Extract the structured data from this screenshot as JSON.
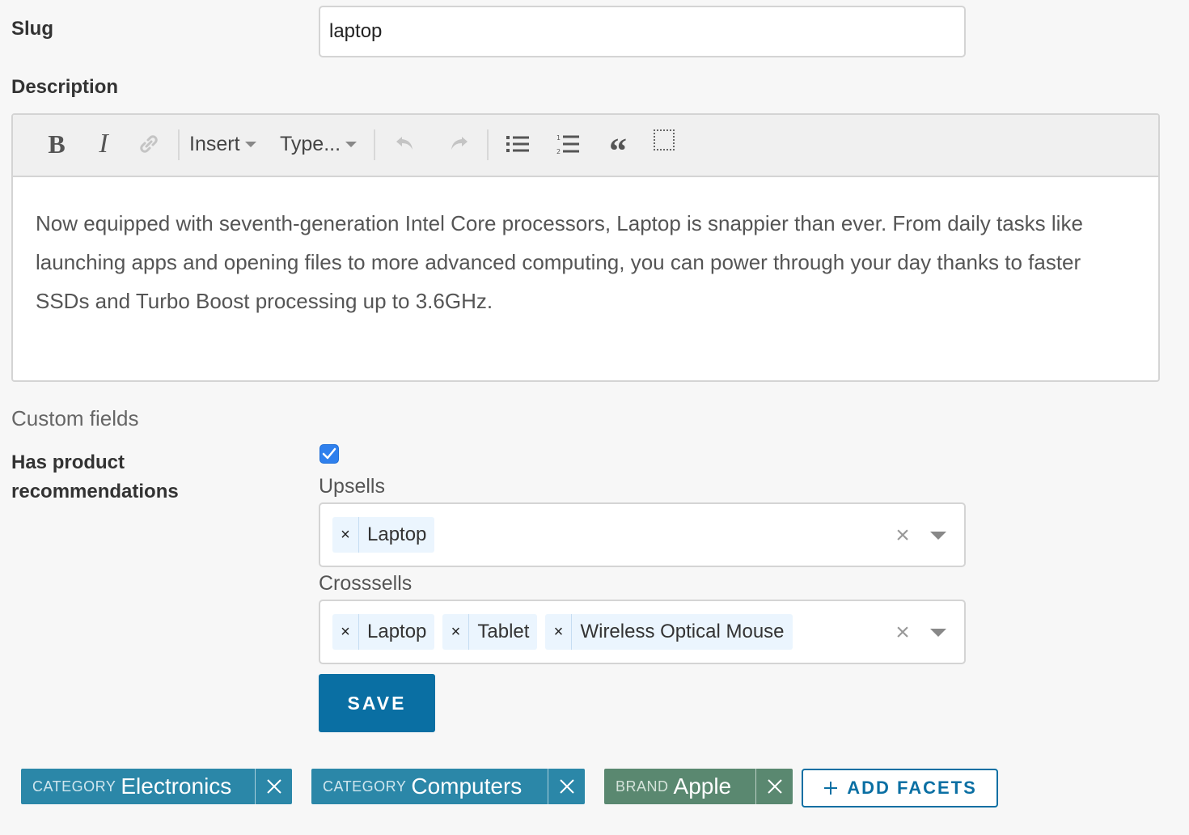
{
  "form": {
    "slug_label": "Slug",
    "slug_value": "laptop",
    "description_label": "Description",
    "description_text": "Now equipped with seventh-generation Intel Core processors, Laptop is snappier than ever. From daily tasks like launching apps and opening files to more advanced computing, you can power through your day thanks to faster SSDs and Turbo Boost processing up to 3.6GHz."
  },
  "toolbar": {
    "bold": "B",
    "italic": "I",
    "insert": "Insert",
    "type": "Type...",
    "quote": "“",
    "icons": [
      "link-icon",
      "undo-icon",
      "redo-icon",
      "bullet-list-icon",
      "numbered-list-icon",
      "blockquote-icon",
      "block-icon"
    ]
  },
  "custom_fields": {
    "heading": "Custom fields",
    "has_recommendations_label": "Has product recommendations",
    "has_recommendations_checked": true,
    "upsells_label": "Upsells",
    "upsells": [
      "Laptop"
    ],
    "crosssells_label": "Crosssells",
    "crosssells": [
      "Laptop",
      "Tablet",
      "Wireless Optical Mouse"
    ]
  },
  "actions": {
    "save_label": "SAVE"
  },
  "facets": [
    {
      "key": "CATEGORY",
      "value": "Electronics",
      "color": "#2b87a8"
    },
    {
      "key": "CATEGORY",
      "value": "Computers",
      "color": "#2b87a8"
    },
    {
      "key": "BRAND",
      "value": "Apple",
      "color": "#5a8870"
    }
  ],
  "add_facets_label": "ADD FACETS",
  "colors": {
    "accent": "#0a6fa3",
    "checkbox": "#2f80ed",
    "tag_bg": "#ebf5fe"
  }
}
